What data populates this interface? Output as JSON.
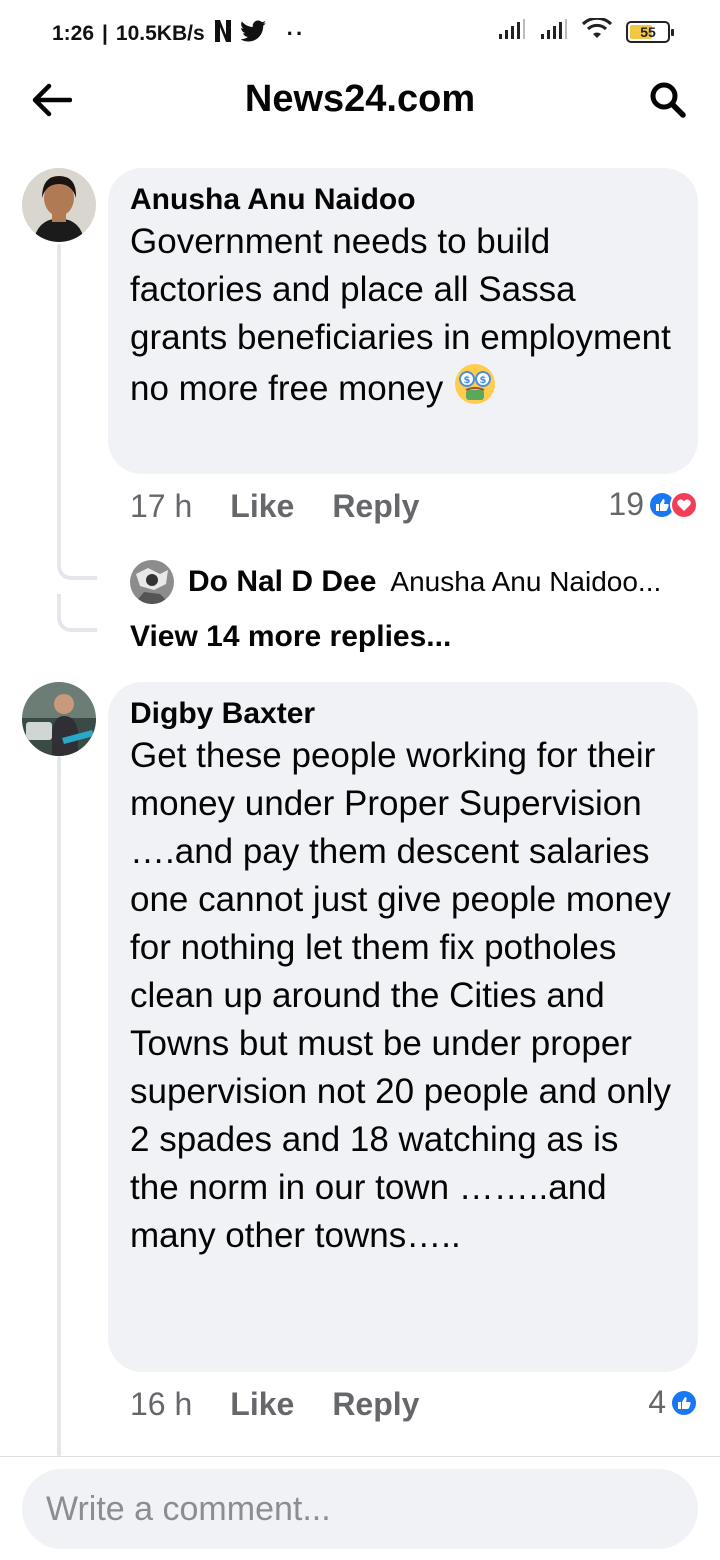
{
  "status_bar": {
    "time": "1:26",
    "network_speed": "10.5KB/s",
    "battery_level": "55",
    "battery_color": "#f2c744",
    "icons": [
      "netflix-icon",
      "twitter-icon",
      "signal-icon",
      "signal-icon",
      "wifi-icon",
      "battery-icon"
    ]
  },
  "header": {
    "title": "News24.com",
    "back_icon": "arrow-left-icon",
    "search_icon": "search-icon"
  },
  "comments": [
    {
      "author": "Anusha Anu Naidoo",
      "text": "Government needs to build factories and place all Sassa grants beneficiaries in employment no more free money",
      "emoji": "money-mouth-face",
      "time": "17 h",
      "like_label": "Like",
      "reply_label": "Reply",
      "reaction_count": "19",
      "reactions": [
        "like",
        "love"
      ],
      "reply_preview": {
        "author": "Do Nal D Dee",
        "snippet": "Anusha Anu Naidoo..."
      },
      "view_more_label": "View 14 more replies..."
    },
    {
      "author": "Digby Baxter",
      "text": "Get these people working for their money under Proper Supervision ….and pay them descent salaries one cannot just give people money for nothing let them fix potholes clean up around the Cities and Towns but must be under proper supervision not 20 people and only 2 spades and 18 watching as is the norm in our town ……..and many other towns…..",
      "time": "16 h",
      "like_label": "Like",
      "reply_label": "Reply",
      "reaction_count": "4",
      "reactions": [
        "like"
      ]
    }
  ],
  "composer": {
    "placeholder": "Write a comment..."
  },
  "colors": {
    "bubble_bg": "#f0f2f5",
    "secondary_text": "#65676b",
    "like_blue": "#1877f2",
    "love_red": "#f33e58"
  }
}
